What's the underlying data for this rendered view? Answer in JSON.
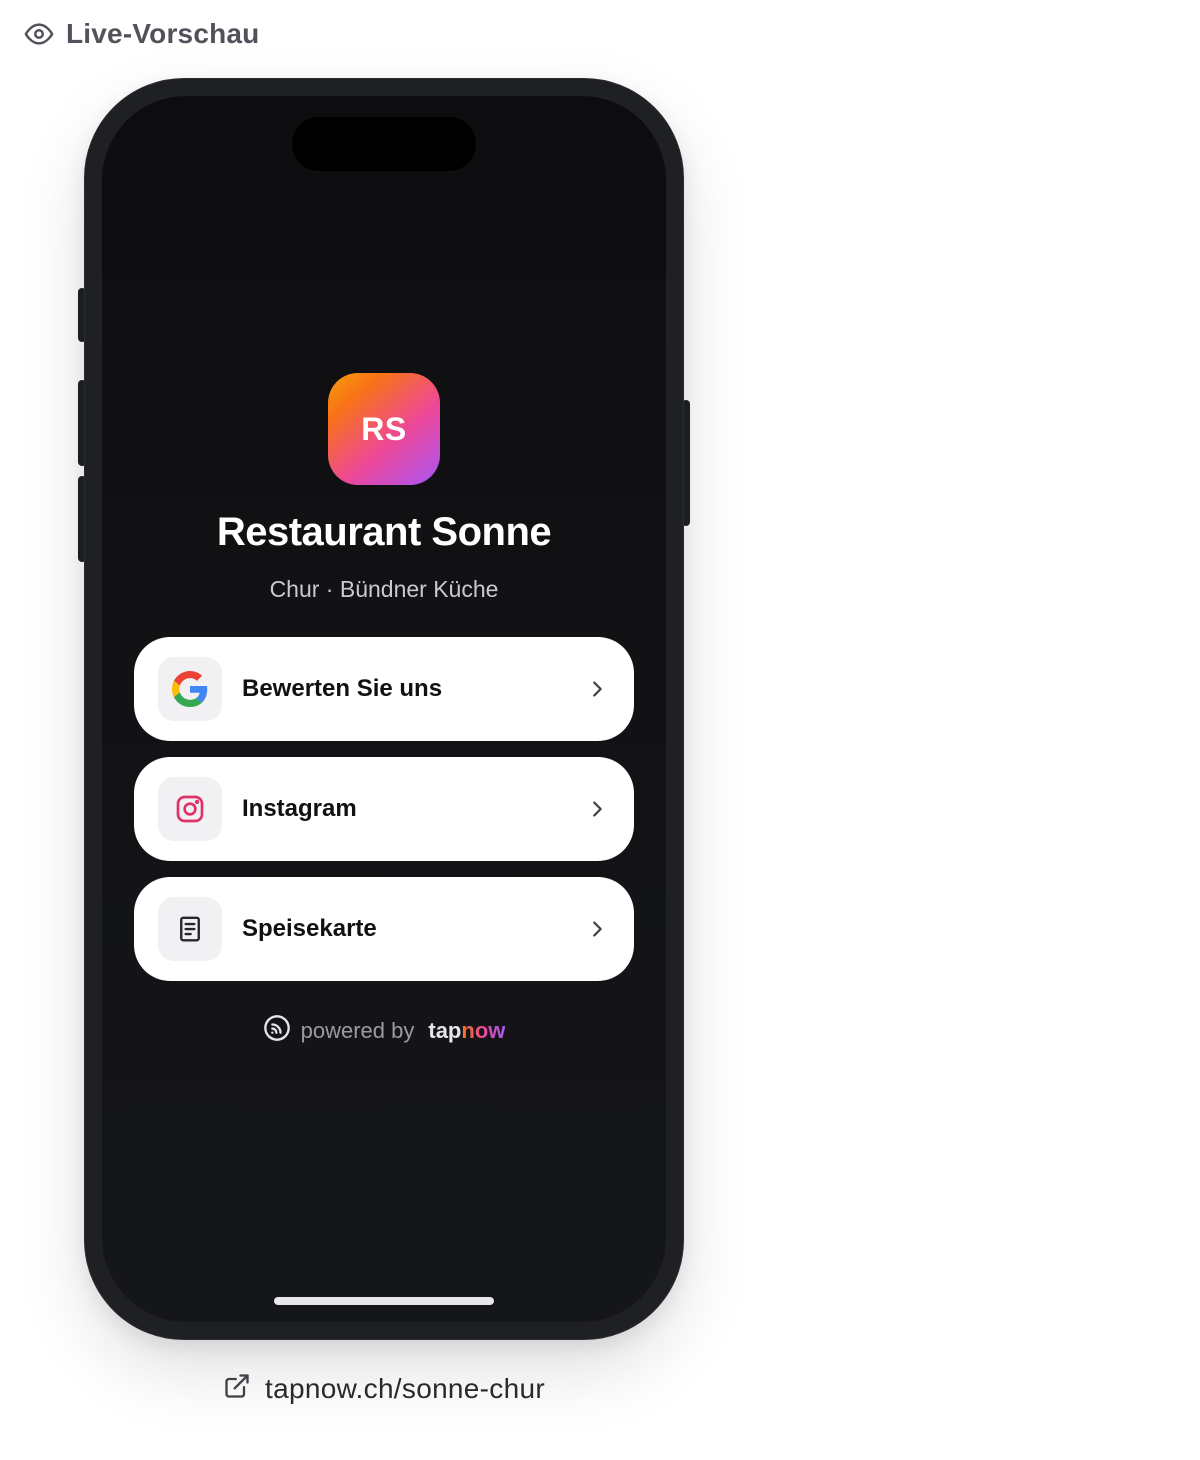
{
  "header": {
    "label": "Live-Vorschau",
    "icon": "eye-icon"
  },
  "profile": {
    "initials": "RS",
    "name": "Restaurant Sonne",
    "subtitle": "Chur · Bündner Küche",
    "avatar_gradient": [
      "#f59e0b",
      "#ec4899",
      "#a855f7"
    ]
  },
  "links": [
    {
      "label": "Bewerten Sie uns",
      "icon": "google-icon"
    },
    {
      "label": "Instagram",
      "icon": "instagram-icon"
    },
    {
      "label": "Speisekarte",
      "icon": "menu-document-icon"
    }
  ],
  "powered": {
    "text": "powered by",
    "brand_tap": "tap",
    "brand_now": "now"
  },
  "footer": {
    "url": "tapnow.ch/sonne-chur",
    "icon": "external-link-icon"
  },
  "colors": {
    "screen_bg": "#121215",
    "card_bg": "#ffffff",
    "instagram": "#e1306c"
  }
}
